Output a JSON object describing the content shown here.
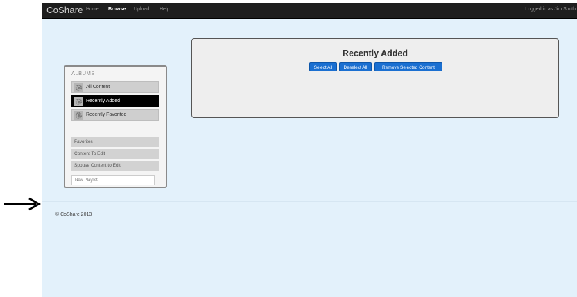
{
  "navbar": {
    "brand": "CoShare",
    "links": [
      "Home",
      "Browse",
      "Upload",
      "Help"
    ],
    "active": "Browse",
    "logged_in": "Logged in as Jim Smith"
  },
  "sidebar": {
    "heading": "ALBUMS",
    "albums": [
      {
        "label": "All Content",
        "icon": "gear-icon"
      },
      {
        "label": "Recently Added",
        "icon": "gear-icon"
      },
      {
        "label": "Recently Favorited",
        "icon": "gear-icon"
      }
    ],
    "lists": [
      "Favorites",
      "Content To Edit",
      "Spouse Content to Edit"
    ],
    "playlist_placeholder": "New Playlist"
  },
  "main": {
    "title": "Recently Added",
    "buttons": {
      "select_all": "Select All",
      "deselect_all": "Deselect All",
      "remove": "Remove Selected Content"
    }
  },
  "footer": {
    "text": "© CoShare 2013"
  },
  "colors": {
    "page_bg": "#e3f1fb",
    "navbar_bg": "#1e1e1e",
    "button_blue": "#1a6fd1",
    "active_album": "#000000"
  }
}
